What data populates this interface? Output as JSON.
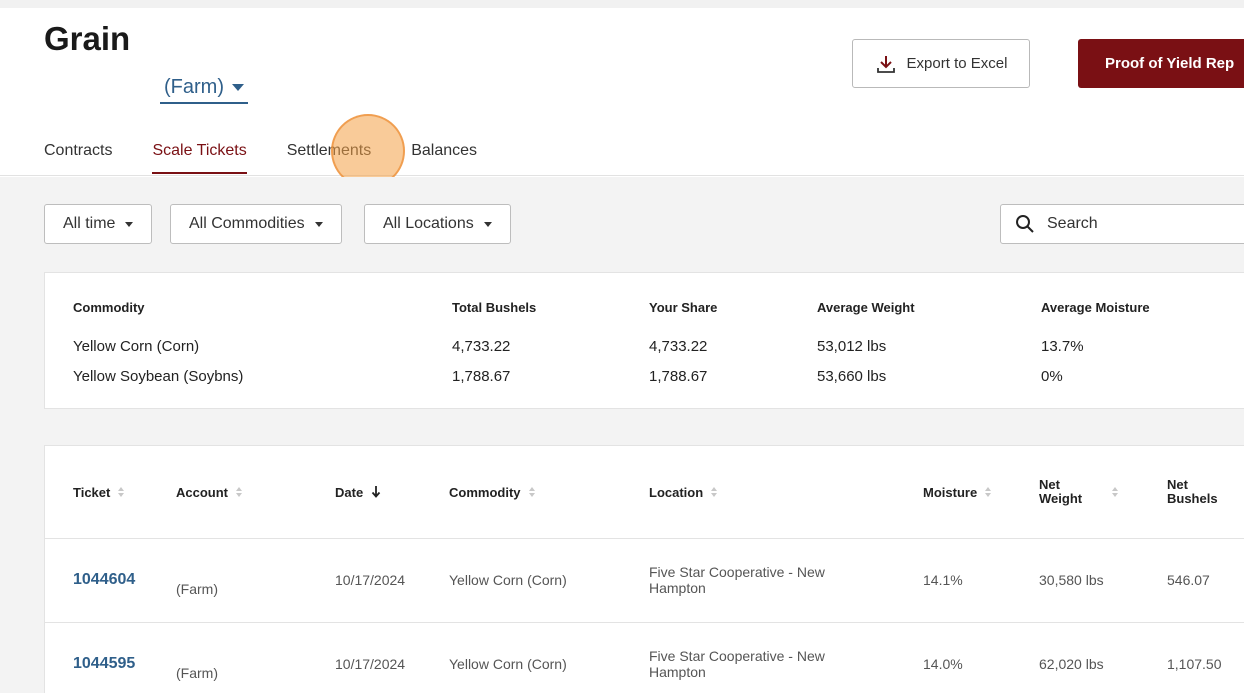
{
  "header": {
    "title": "Grain",
    "farm_selector": "(Farm)",
    "export_label": "Export to Excel",
    "proof_label": "Proof of Yield Rep"
  },
  "tabs": [
    {
      "label": "Contracts",
      "active": false
    },
    {
      "label": "Scale Tickets",
      "active": true
    },
    {
      "label": "Settlements",
      "active": false
    },
    {
      "label": "Balances",
      "active": false
    }
  ],
  "filters": {
    "time": "All time",
    "commodities": "All Commodities",
    "locations": "All Locations",
    "search_placeholder": "Search"
  },
  "summary": {
    "headers": [
      "Commodity",
      "Total Bushels",
      "Your Share",
      "Average Weight",
      "Average Moisture"
    ],
    "rows": [
      [
        "Yellow Corn (Corn)",
        "4,733.22",
        "4,733.22",
        "53,012 lbs",
        "13.7%"
      ],
      [
        "Yellow Soybean (Soybns)",
        "1,788.67",
        "1,788.67",
        "53,660 lbs",
        "0%"
      ]
    ]
  },
  "tickets": {
    "headers": {
      "ticket": "Ticket",
      "account": "Account",
      "date": "Date",
      "commodity": "Commodity",
      "location": "Location",
      "moisture": "Moisture",
      "net_weight_1": "Net",
      "net_weight_2": "Weight",
      "net_bushels_1": "Net",
      "net_bushels_2": "Bushels"
    },
    "rows": [
      {
        "ticket": "1044604",
        "account": "(Farm)",
        "date": "10/17/2024",
        "commodity": "Yellow Corn (Corn)",
        "location": "Five Star Cooperative - New Hampton",
        "moisture": "14.1%",
        "net_weight": "30,580 lbs",
        "net_bushels": "546.07"
      },
      {
        "ticket": "1044595",
        "account": "(Farm)",
        "date": "10/17/2024",
        "commodity": "Yellow Corn (Corn)",
        "location": "Five Star Cooperative - New Hampton",
        "moisture": "14.0%",
        "net_weight": "62,020 lbs",
        "net_bushels": "1,107.50"
      }
    ]
  },
  "colors": {
    "brand": "#7a1014",
    "link": "#2f5f8a",
    "click_indicator": "#f4a046"
  }
}
